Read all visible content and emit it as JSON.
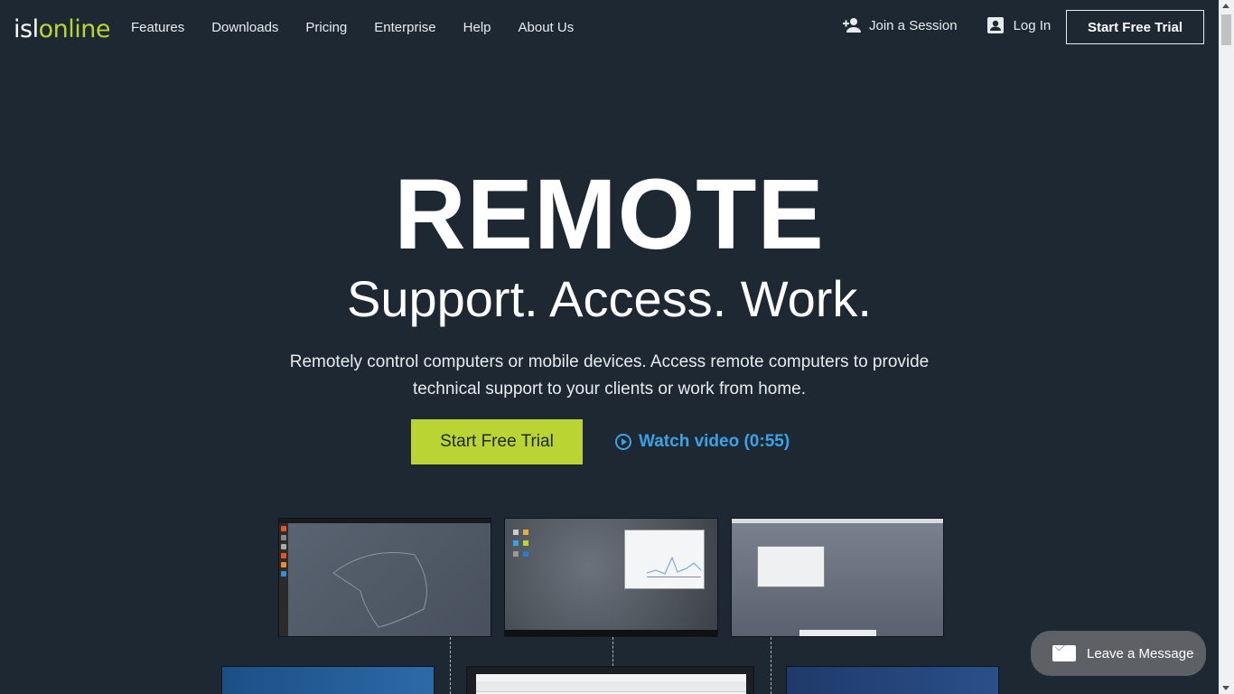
{
  "header": {
    "logo": {
      "isl": "isl",
      "online": "online"
    },
    "nav": [
      "Features",
      "Downloads",
      "Pricing",
      "Enterprise",
      "Help",
      "About Us"
    ],
    "join_label": "Join a Session",
    "login_label": "Log In",
    "trial_label": "Start Free Trial",
    "join_icon": "add-person-icon",
    "login_icon": "account-box-icon"
  },
  "hero": {
    "title": "REMOTE",
    "subtitle": "Support. Access. Work.",
    "desc_line1": "Remotely control computers or mobile devices. Access remote computers to provide",
    "desc_line2": "technical support to your clients or work from home.",
    "cta_label": "Start Free Trial",
    "watch_label": "Watch video (0:55)",
    "watch_icon": "play-circle-icon"
  },
  "chat": {
    "label": "Leave a Message",
    "icon": "envelope-icon"
  },
  "colors": {
    "background": "#1d2833",
    "accent": "#b9d433",
    "link": "#3aa3e3"
  }
}
